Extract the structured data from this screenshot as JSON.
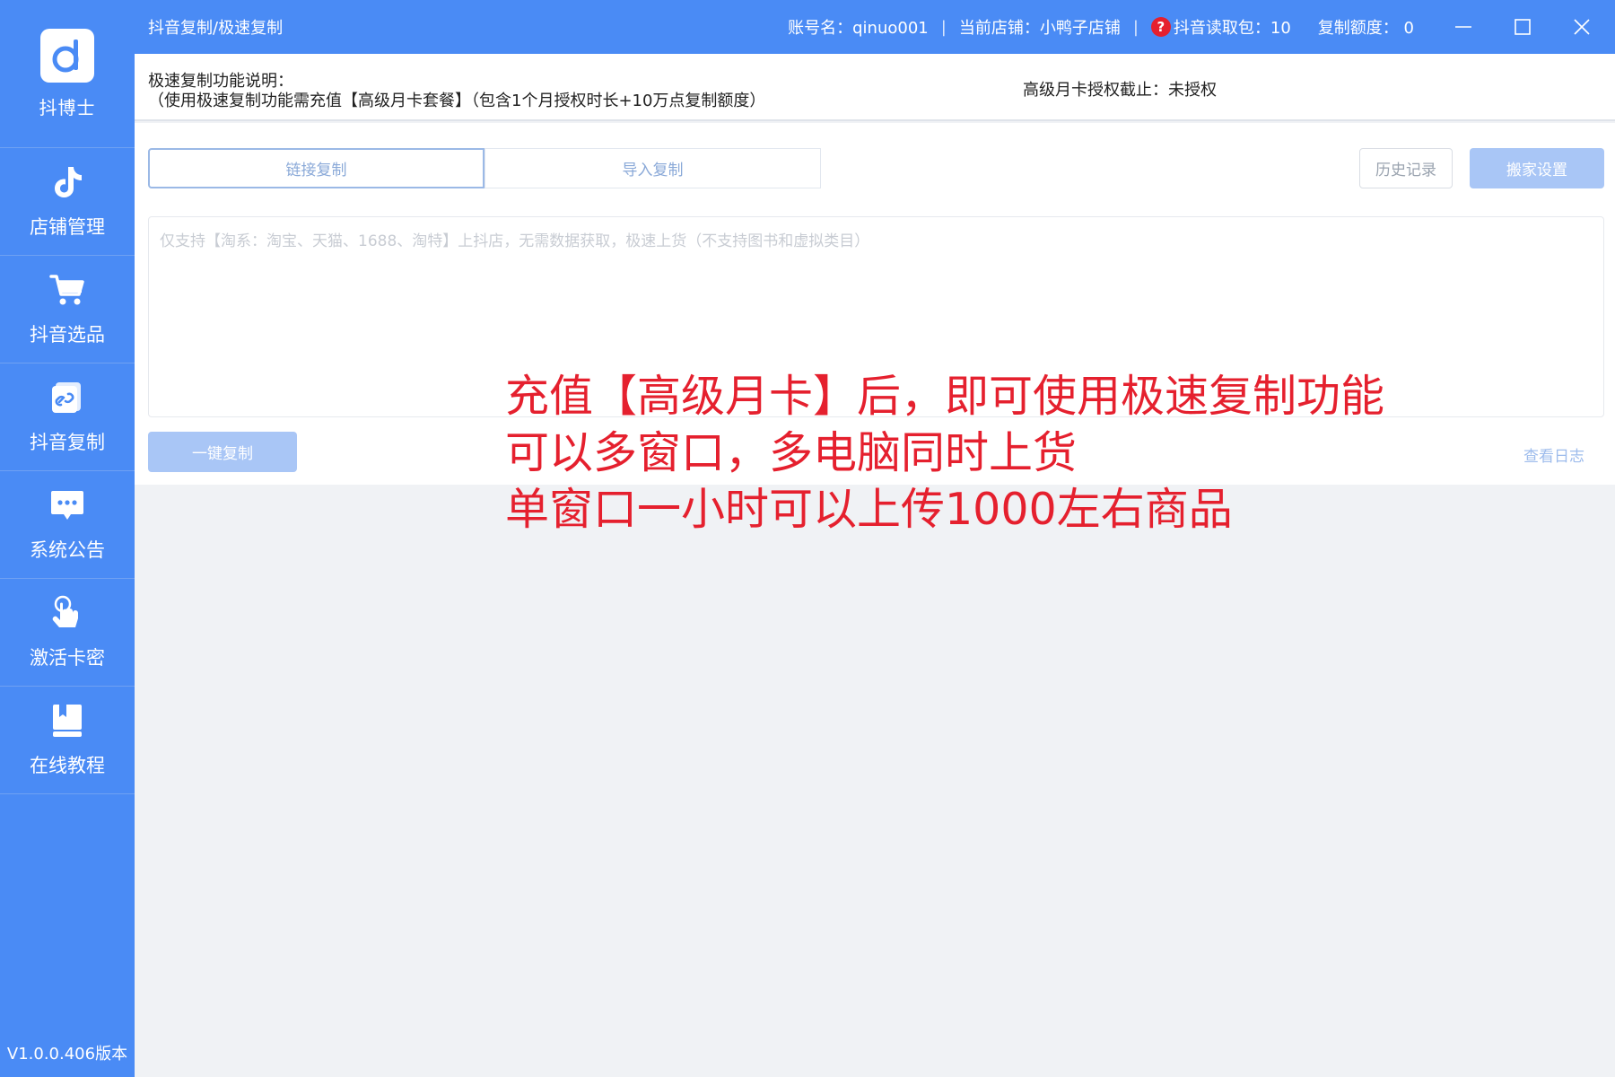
{
  "app": {
    "logo_name": "抖博士",
    "version": "V1.0.0.406版本"
  },
  "sidebar": {
    "items": [
      {
        "label": "店铺管理",
        "icon": "tiktok-icon"
      },
      {
        "label": "抖音选品",
        "icon": "cart-icon"
      },
      {
        "label": "抖音复制",
        "icon": "link-copy-icon"
      },
      {
        "label": "系统公告",
        "icon": "chat-icon"
      },
      {
        "label": "激活卡密",
        "icon": "touch-hand-icon"
      },
      {
        "label": "在线教程",
        "icon": "book-icon"
      }
    ]
  },
  "titlebar": {
    "title": "抖音复制/极速复制",
    "account": "账号名：qinuo001",
    "sep": "|",
    "store": "当前店铺：小鸭子店铺",
    "help": "?",
    "read_pack": "抖音读取包：10",
    "copy_quota": "复制额度：  0"
  },
  "info": {
    "title": "极速复制功能说明：",
    "desc": "（使用极速复制功能需充值【高级月卡套餐】（包含1个月授权时长+10万点复制额度）",
    "auth": "高级月卡授权截止：未授权"
  },
  "main": {
    "tabs": [
      {
        "label": "链接复制"
      },
      {
        "label": "导入复制"
      }
    ],
    "history_label": "历史记录",
    "setting_label": "搬家设置",
    "textarea_placeholder": "仅支持【淘系：淘宝、天猫、1688、淘特】上抖店，无需数据获取，极速上货（不支持图书和虚拟类目）",
    "copy_label": "一键复制",
    "log_label": "查看日志"
  },
  "overlay": {
    "line1": "充值【高级月卡】后，即可使用极速复制功能",
    "line2": "可以多窗口，多电脑同时上货",
    "line3": "单窗口一小时可以上传1000左右商品"
  },
  "colors": {
    "brand": "#4a8bf5",
    "overlay_red": "#e5202e",
    "button_disabled": "#a9c6f6"
  }
}
